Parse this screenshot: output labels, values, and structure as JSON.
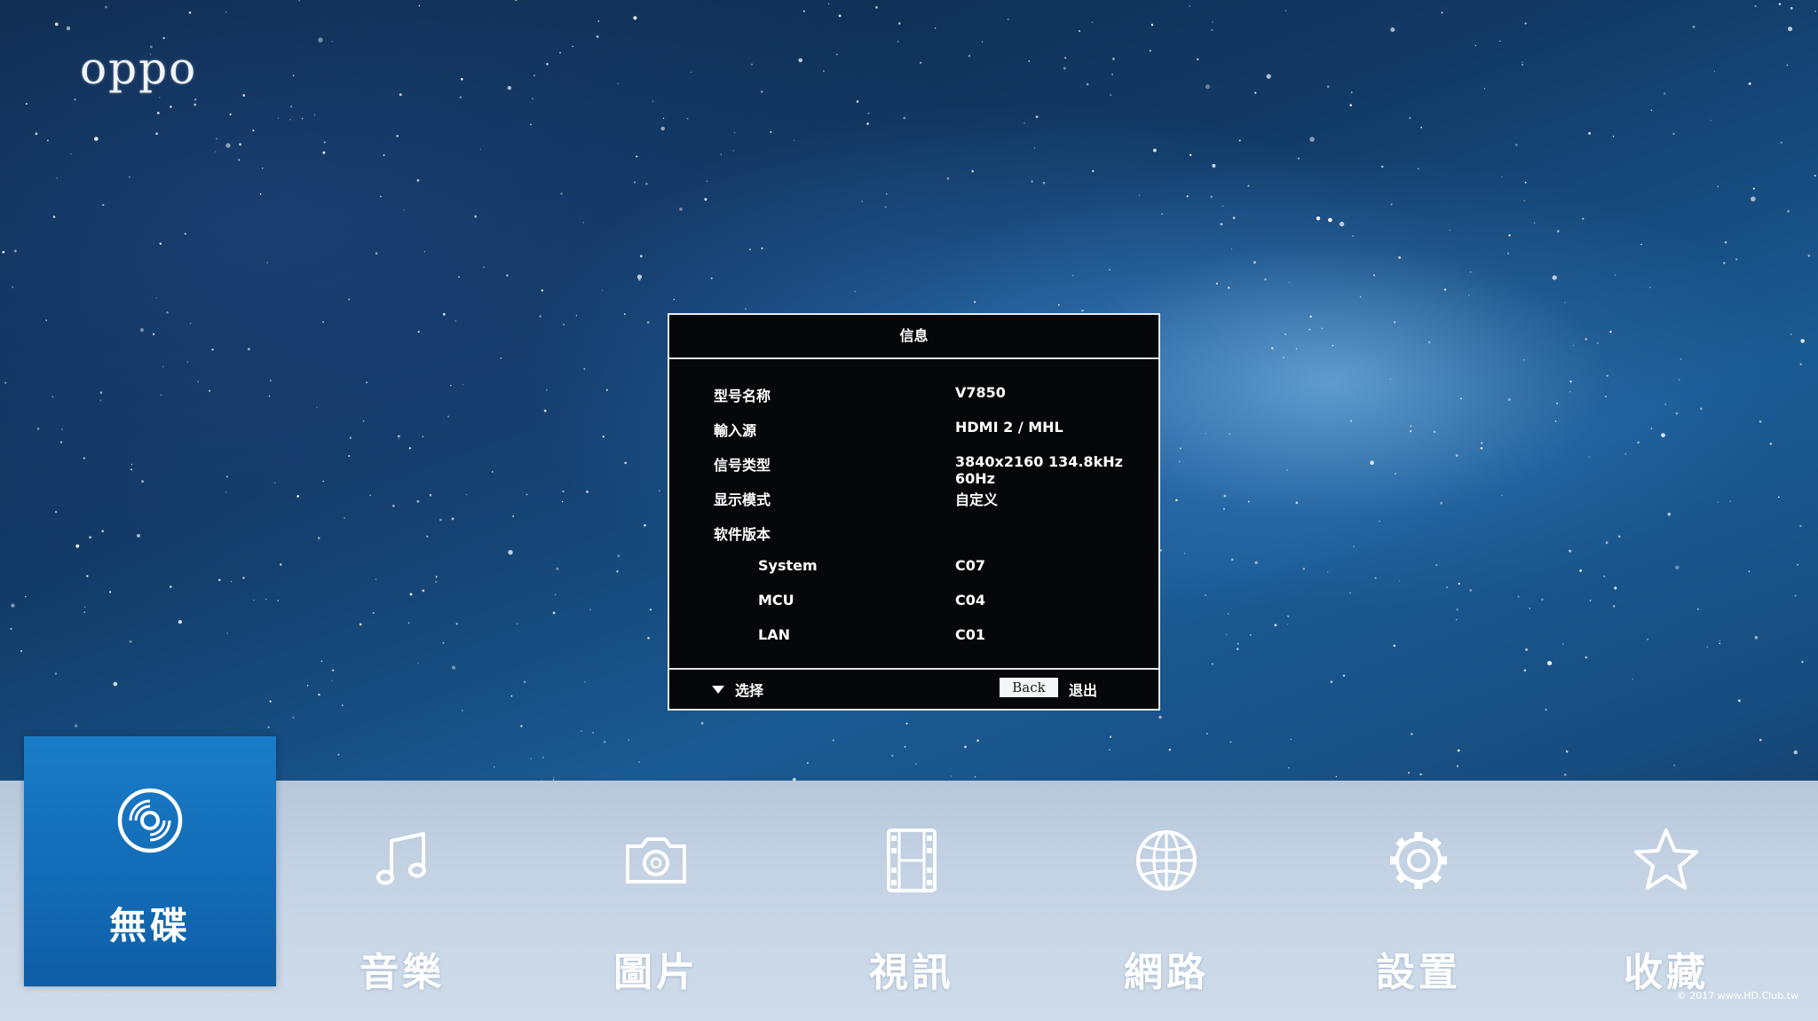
{
  "brand": {
    "logo_text": "oppo"
  },
  "dialog": {
    "title": "信息",
    "rows": [
      {
        "label": "型号名称",
        "value": "V7850"
      },
      {
        "label": "輸入源",
        "value": "HDMI 2 / MHL"
      },
      {
        "label": "信号类型",
        "value": "3840x2160 134.8kHz 60Hz"
      },
      {
        "label": "显示模式",
        "value": "自定义"
      },
      {
        "label": "软件版本",
        "value": ""
      },
      {
        "label": "System",
        "value": "C07"
      },
      {
        "label": "MCU",
        "value": "C04"
      },
      {
        "label": "LAN",
        "value": "C01"
      }
    ],
    "footer": {
      "select_label": "选择",
      "back_button": "Back",
      "exit_label": "退出"
    }
  },
  "menu": {
    "items": [
      {
        "label": "無碟",
        "icon": "disc-icon",
        "selected": true
      },
      {
        "label": "音樂",
        "icon": "music-note-icon"
      },
      {
        "label": "圖片",
        "icon": "camera-icon"
      },
      {
        "label": "視訊",
        "icon": "film-icon"
      },
      {
        "label": "網路",
        "icon": "globe-icon"
      },
      {
        "label": "設置",
        "icon": "gear-icon"
      },
      {
        "label": "收藏",
        "icon": "star-icon"
      }
    ]
  },
  "watermark": {
    "text": "© 2017 www.HD.Club.tw"
  },
  "colors": {
    "dialog_bg": "#05070b",
    "selected_tile": "#136db8",
    "bottom_bar": "#c4d3e4"
  }
}
